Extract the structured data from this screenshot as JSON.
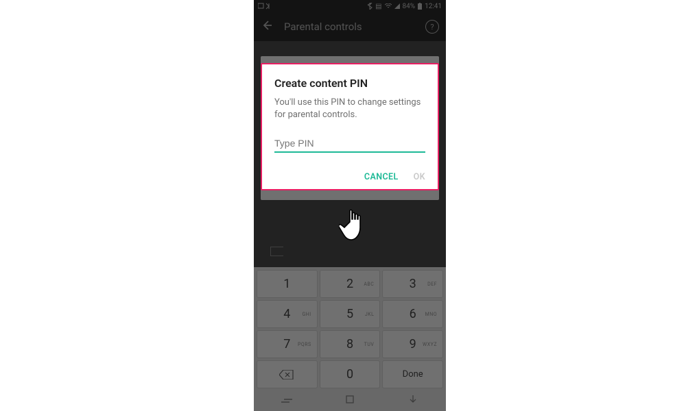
{
  "status": {
    "battery": "84%",
    "time": "12:41"
  },
  "toolbar": {
    "title": "Parental controls"
  },
  "dialog": {
    "title": "Create content PIN",
    "body": "You'll use this PIN to change settings for parental controls.",
    "placeholder": "Type PIN",
    "cancel": "CANCEL",
    "ok": "OK"
  },
  "keypad": {
    "rows": [
      [
        {
          "d": "1",
          "s": ""
        },
        {
          "d": "2",
          "s": "ABC"
        },
        {
          "d": "3",
          "s": "DEF"
        }
      ],
      [
        {
          "d": "4",
          "s": "GHI"
        },
        {
          "d": "5",
          "s": "JKL"
        },
        {
          "d": "6",
          "s": "MNO"
        }
      ],
      [
        {
          "d": "7",
          "s": "PQRS"
        },
        {
          "d": "8",
          "s": "TUV"
        },
        {
          "d": "9",
          "s": "WXYZ"
        }
      ]
    ],
    "zero": "0",
    "done": "Done"
  }
}
